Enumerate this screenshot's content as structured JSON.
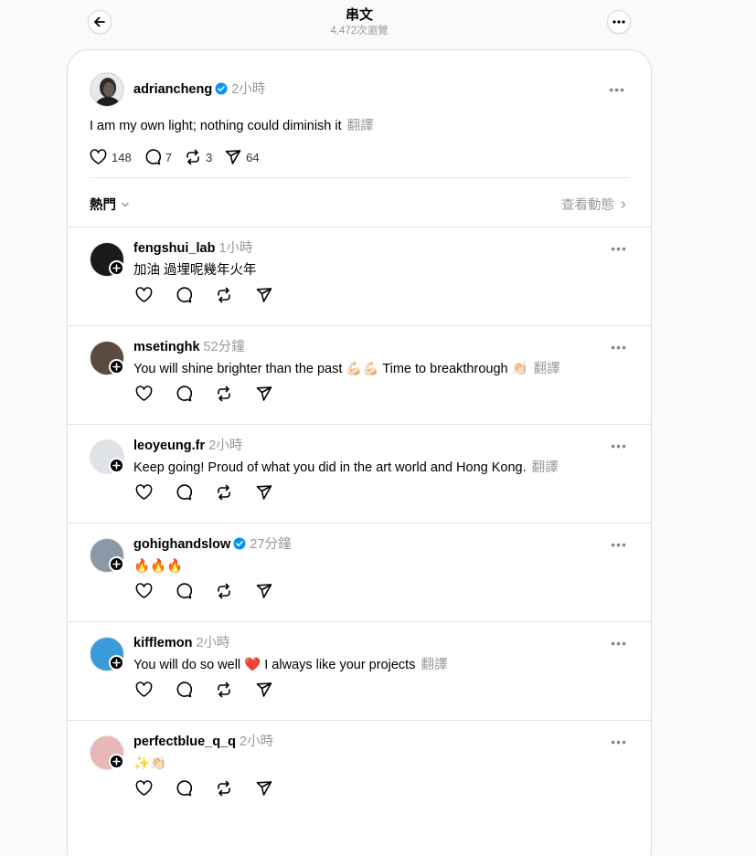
{
  "header": {
    "title": "串文",
    "views": "4,472次瀏覽",
    "back_icon": "arrow-left-icon",
    "more_icon": "more-icon"
  },
  "post": {
    "username": "adriancheng",
    "verified": true,
    "time": "2小時",
    "text": "I am my own light; nothing could diminish it",
    "translate": "翻譯",
    "likes": "148",
    "comments": "7",
    "reposts": "3",
    "shares": "64"
  },
  "filter": {
    "sort_label": "熱門",
    "activity_label": "查看動態"
  },
  "replies": [
    {
      "username": "fengshui_lab",
      "verified": false,
      "time": "1小時",
      "text": "加油 過埋呢幾年火年",
      "translate": "",
      "avatar_color": "#1a1a1a"
    },
    {
      "username": "msetinghk",
      "verified": false,
      "time": "52分鐘",
      "text": "You will shine brighter than the past 💪🏻💪🏻 Time to breakthrough 👏🏻",
      "translate": "翻譯",
      "avatar_color": "#5a4a3f"
    },
    {
      "username": "leoyeung.fr",
      "verified": false,
      "time": "2小時",
      "text": "Keep going! Proud of what you did in the art world and Hong Kong.",
      "translate": "翻譯",
      "avatar_color": "#dfe3e8"
    },
    {
      "username": "gohighandslow",
      "verified": true,
      "time": "27分鐘",
      "text": "🔥🔥🔥",
      "translate": "",
      "avatar_color": "#8a98a8"
    },
    {
      "username": "kifflemon",
      "verified": false,
      "time": "2小時",
      "text": "You will do so well ❤️ I always like your projects",
      "translate": "翻譯",
      "avatar_color": "#3b9ad9"
    },
    {
      "username": "perfectblue_q_q",
      "verified": false,
      "time": "2小時",
      "text": "✨👏🏻",
      "translate": "",
      "avatar_color": "#e8b7b7"
    }
  ],
  "colors": {
    "verified_blue": "#0095f6",
    "muted": "#999999",
    "divider": "#e4e4e4"
  }
}
